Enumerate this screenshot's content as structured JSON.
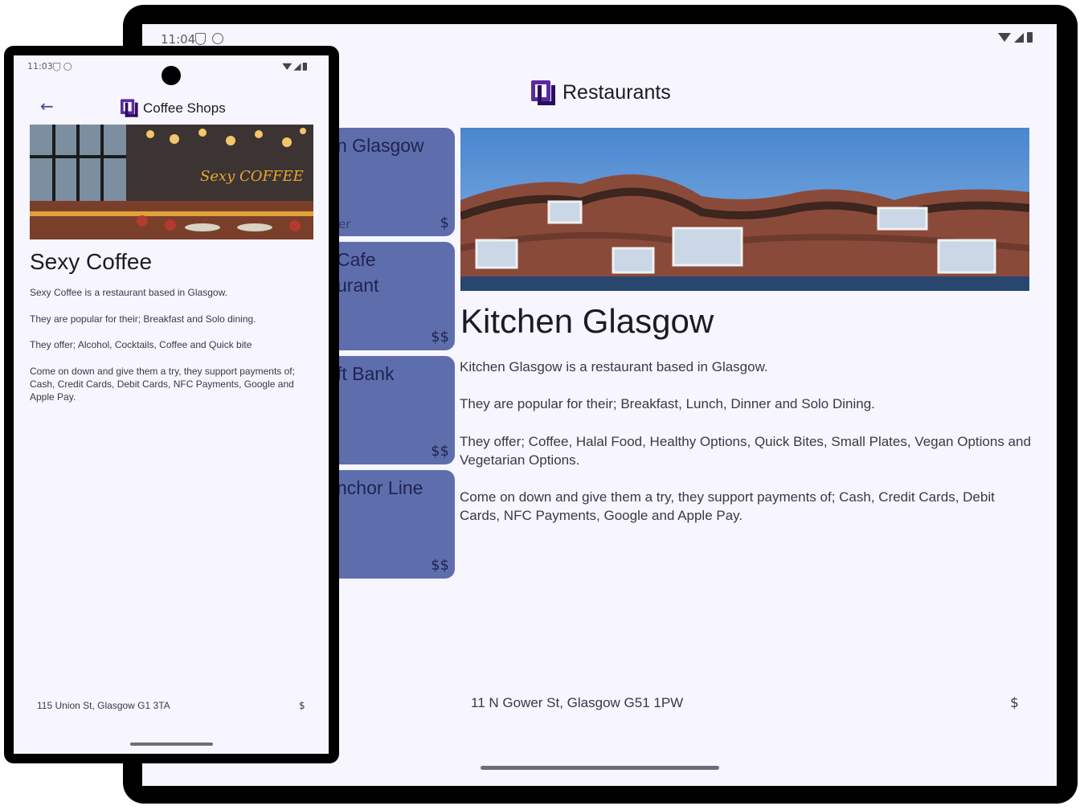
{
  "tablet": {
    "status": {
      "time": "11:04",
      "icons": [
        "shield-icon",
        "vpn-icon",
        "wifi-icon",
        "signal-icon",
        "battery-icon"
      ]
    },
    "header": {
      "title": "Restaurants",
      "logo": "app-logo"
    },
    "list": [
      {
        "name": "n Glasgow",
        "subtitle": "er",
        "price": "$"
      },
      {
        "name": "Cafe\nurant",
        "subtitle": "",
        "price": "$$"
      },
      {
        "name": "ft Bank",
        "subtitle": "",
        "price": "$$"
      },
      {
        "name": "nchor Line",
        "subtitle": "",
        "price": "$$"
      }
    ],
    "detail": {
      "title": "Kitchen Glasgow",
      "description": "Kitchen Glasgow is a restaurant based in Glasgow.",
      "popular": "They are popular for their; Breakfast, Lunch, Dinner and Solo Dining.",
      "offers": "They offer; Coffee, Halal Food, Healthy Options, Quick Bites, Small Plates, Vegan Options and Vegetarian Options.",
      "payments": "Come on down and give them a try, they support payments of; Cash, Credit Cards, Debit Cards, NFC Payments, Google and Apple Pay.",
      "address": "11 N Gower St, Glasgow G51 1PW",
      "price": "$"
    }
  },
  "phone": {
    "status": {
      "time": "11:03",
      "icons": [
        "shield-icon",
        "vpn-icon",
        "wifi-icon",
        "signal-icon",
        "battery-icon"
      ]
    },
    "header": {
      "title": "Coffee Shops",
      "back_icon": "←",
      "logo": "app-logo"
    },
    "detail": {
      "title": "Sexy Coffee",
      "description": "Sexy Coffee is a restaurant based in Glasgow.",
      "popular": "They are popular for their; Breakfast and Solo dining.",
      "offers": "They offer; Alcohol, Cocktails, Coffee and Quick bite",
      "payments": "Come on down and give them a try, they support payments of; Cash, Credit Cards, Debit Cards, NFC Payments, Google and Apple Pay.",
      "address": "115 Union St, Glasgow G1 3TA",
      "price": "$",
      "hero_sign": "Sexy COFFEE"
    }
  },
  "colors": {
    "accent": "#5b2aa0",
    "card": "#5e6ead",
    "background": "#f7f5fd"
  }
}
